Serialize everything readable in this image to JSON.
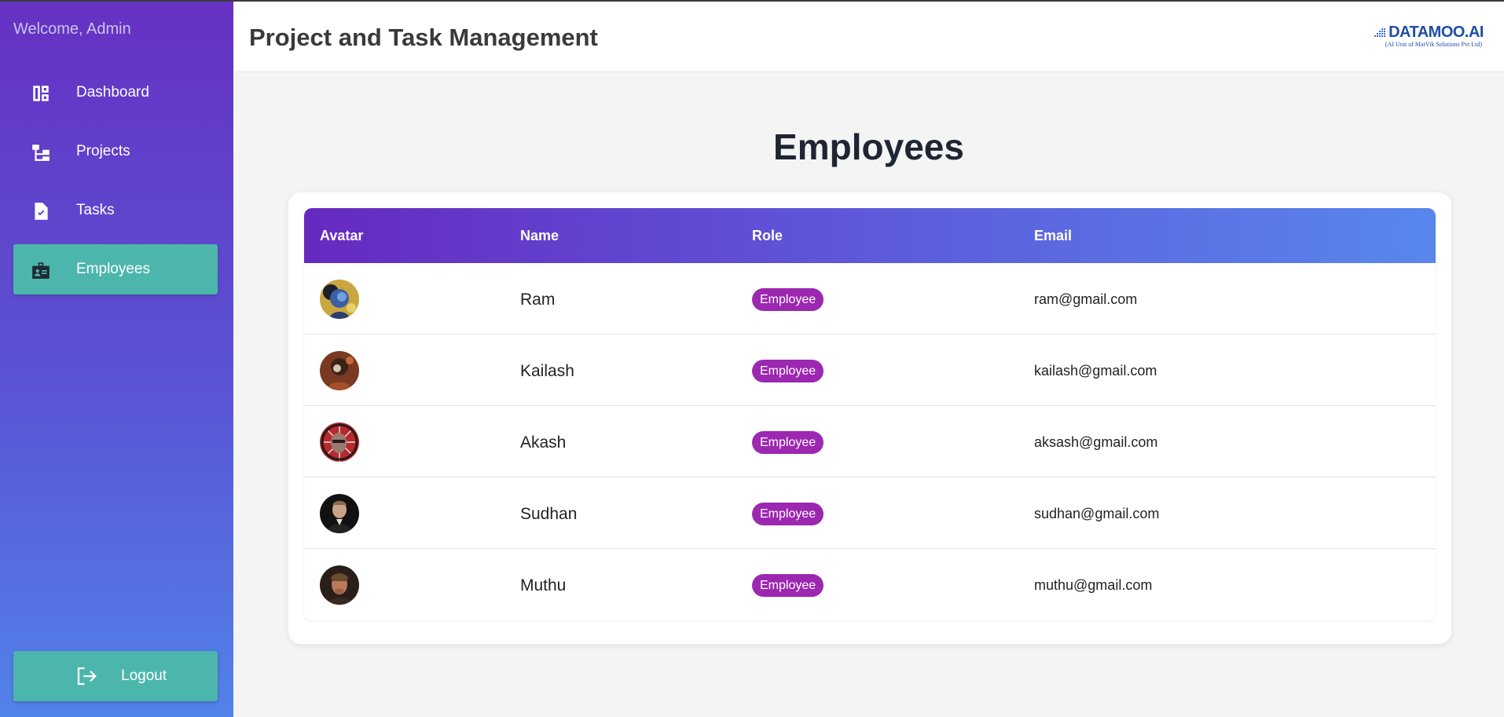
{
  "sidebar": {
    "welcome": "Welcome, Admin",
    "items": [
      {
        "label": "Dashboard",
        "icon": "dashboard-icon"
      },
      {
        "label": "Projects",
        "icon": "account-tree-icon"
      },
      {
        "label": "Tasks",
        "icon": "task-file-icon"
      },
      {
        "label": "Employees",
        "icon": "badge-icon",
        "active": true
      }
    ],
    "logout_label": "Logout"
  },
  "header": {
    "title": "Project and Task Management",
    "logo_main": "DATAMOO.AI",
    "logo_sub": "(AI Unit of MatVik Solutions Pvt Ltd)"
  },
  "main": {
    "page_title": "Employees",
    "table": {
      "columns": [
        "Avatar",
        "Name",
        "Role",
        "Email"
      ],
      "rows": [
        {
          "name": "Ram",
          "role": "Employee",
          "email": "ram@gmail.com"
        },
        {
          "name": "Kailash",
          "role": "Employee",
          "email": "kailash@gmail.com"
        },
        {
          "name": "Akash",
          "role": "Employee",
          "email": "aksash@gmail.com"
        },
        {
          "name": "Sudhan",
          "role": "Employee",
          "email": "sudhan@gmail.com"
        },
        {
          "name": "Muthu",
          "role": "Employee",
          "email": "muthu@gmail.com"
        }
      ]
    }
  },
  "colors": {
    "accent_teal": "#4db6ac",
    "role_badge": "#9c27b0",
    "sidebar_top": "#6631c3",
    "sidebar_bottom": "#5283ea"
  }
}
